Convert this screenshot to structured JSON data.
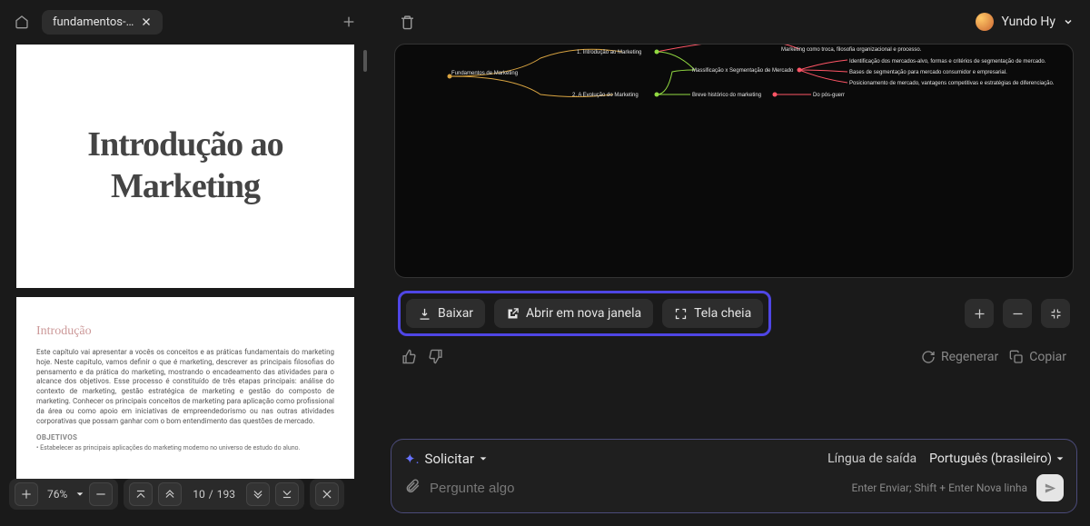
{
  "tabs": {
    "file_name": "fundamentos-…"
  },
  "user": {
    "name": "Yundo Hy"
  },
  "pdf": {
    "zoom_percent": "76%",
    "current_page": "10",
    "page_sep": "/",
    "total_pages": "193",
    "page_title": "Introdução ao Marketing",
    "section_heading": "Introdução",
    "body_text": "Este capítulo vai apresentar a vocês os conceitos e as práticas fundamentais do marketing hoje. Neste capítulo, vamos definir o que é marketing, descrever as principais filosofias do pensamento e da prática do marketing, mostrando o encadeamento das atividades para o alcance dos objetivos. Esse processo é constituído de três etapas principais: análise do contexto de marketing, gestão estratégica de marketing e gestão do composto de marketing.        Conhecer os principais conceitos de marketing para aplicação como profissional da área ou como apoio em iniciativas de empreendedorismo ou nas outras atividades corporativas que possam ganhar com o bom entendimento das questões de mercado.",
    "objectives_label": "OBJETIVOS",
    "objective_item": "• Estabelecer as principais aplicações do marketing moderno no universo de estudo do aluno."
  },
  "mindmap": {
    "root": "Fundamentos de Marketing",
    "n1": "1. Introdução ao Marketing",
    "n2": "2. A Evolução do Marketing",
    "n2a": "Massificação x Segmentação de Mercado",
    "n2b": "Breve histórico do marketing",
    "leaf1": "Marketing como troca, filosofia organizacional e processo.",
    "leaf2": "Identificação dos mercados-alvo, formas e critérios de segmentação de mercado.",
    "leaf3": "Bases de segmentação para mercado consumidor e empresarial.",
    "leaf4": "Posicionamento de mercado, vantagens competitivas e estratégias de diferenciação.",
    "leaf5": "Do pós-guerr"
  },
  "actions": {
    "download": "Baixar",
    "open_new_window": "Abrir em nova janela",
    "fullscreen": "Tela cheia",
    "regenerate": "Regenerar",
    "copy": "Copiar"
  },
  "prompt": {
    "request_label": "Solicitar",
    "output_lang_label": "Língua de saída",
    "selected_lang": "Português (brasileiro)",
    "placeholder": "Pergunte algo",
    "shortcut": "Enter Enviar; Shift + Enter Nova linha"
  }
}
